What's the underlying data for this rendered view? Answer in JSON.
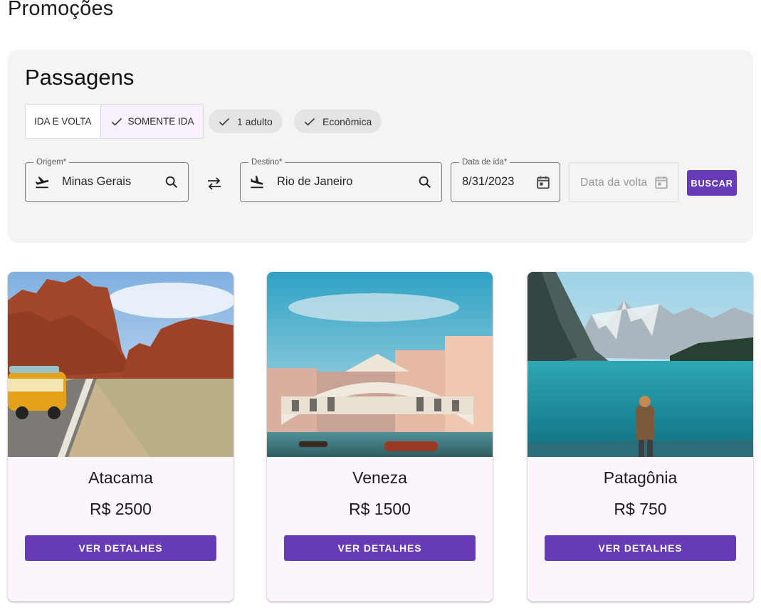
{
  "page": {
    "title": "Promoções"
  },
  "search": {
    "title": "Passagens",
    "trip_types": [
      {
        "label": "IDA E VOLTA",
        "selected": false
      },
      {
        "label": "SOMENTE IDA",
        "selected": true
      }
    ],
    "passengers_chip": "1 adulto",
    "class_chip": "Econômica",
    "origin": {
      "label": "Origem*",
      "value": "Minas Gerais",
      "icon": "airplane-departure-icon"
    },
    "destination": {
      "label": "Destino*",
      "value": "Rio de Janeiro",
      "icon": "airplane-arrival-icon"
    },
    "departure_date": {
      "label": "Data de ida*",
      "value": "8/31/2023",
      "icon": "calendar-icon"
    },
    "return_date": {
      "placeholder": "Data da volta",
      "icon": "calendar-icon",
      "disabled": true
    },
    "search_button": "BUSCAR"
  },
  "promotions": [
    {
      "destination": "Atacama",
      "price": "R$ 2500",
      "button": "VER DETALHES"
    },
    {
      "destination": "Veneza",
      "price": "R$ 1500",
      "button": "VER DETALHES"
    },
    {
      "destination": "Patagônia",
      "price": "R$ 750",
      "button": "VER DETALHES"
    }
  ],
  "colors": {
    "primary": "#673ab7",
    "panel": "#f4f4f4",
    "card": "#fcf5fd",
    "chip": "#e4e4e4"
  }
}
